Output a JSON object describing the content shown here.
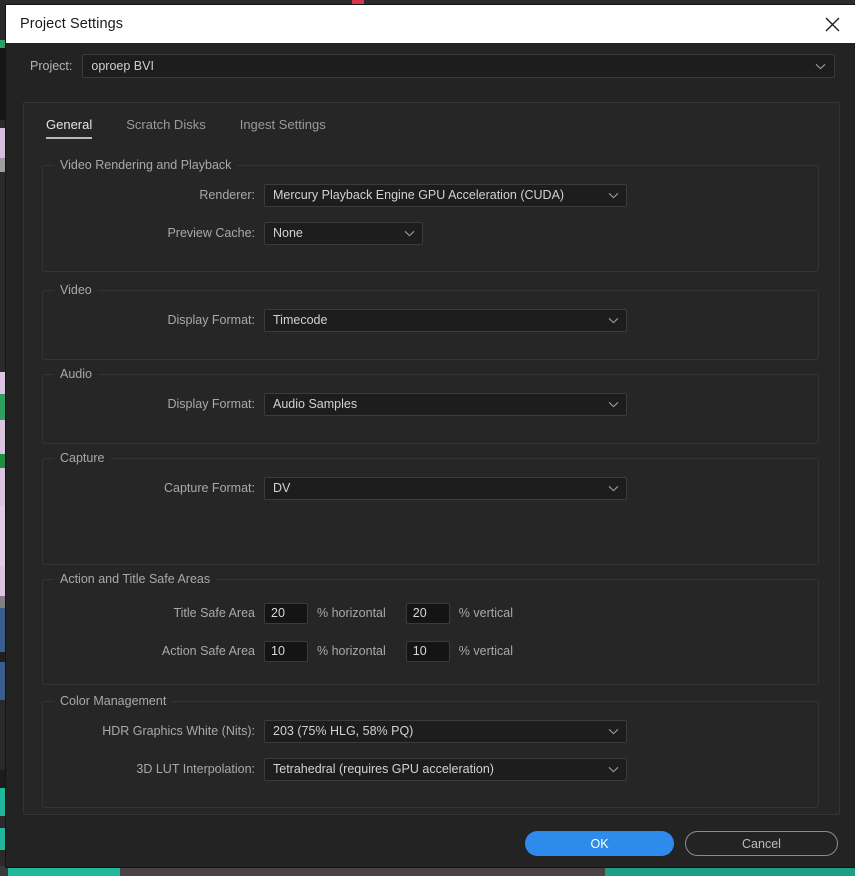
{
  "window": {
    "title": "Project Settings",
    "close_icon": "close-icon"
  },
  "project_row": {
    "label": "Project:",
    "value": "oproep BVI",
    "chevron_icon": "chevron-down-icon"
  },
  "tabs": [
    {
      "label": "General",
      "active": true
    },
    {
      "label": "Scratch Disks",
      "active": false
    },
    {
      "label": "Ingest Settings",
      "active": false
    }
  ],
  "groups": {
    "video_rendering": {
      "legend": "Video Rendering and Playback",
      "renderer": {
        "label": "Renderer:",
        "value": "Mercury Playback Engine GPU Acceleration (CUDA)"
      },
      "preview_cache": {
        "label": "Preview Cache:",
        "value": "None"
      }
    },
    "video": {
      "legend": "Video",
      "display_format": {
        "label": "Display Format:",
        "value": "Timecode"
      }
    },
    "audio": {
      "legend": "Audio",
      "display_format": {
        "label": "Display Format:",
        "value": "Audio Samples"
      }
    },
    "capture": {
      "legend": "Capture",
      "capture_format": {
        "label": "Capture Format:",
        "value": "DV"
      }
    },
    "safe_areas": {
      "legend": "Action and Title Safe Areas",
      "title_safe": {
        "label": "Title Safe Area",
        "horizontal": "20",
        "vertical": "20"
      },
      "action_safe": {
        "label": "Action Safe Area",
        "horizontal": "10",
        "vertical": "10"
      },
      "unit_horizontal": "% horizontal",
      "unit_vertical": "% vertical"
    },
    "color_management": {
      "legend": "Color Management",
      "hdr_white": {
        "label": "HDR Graphics White (Nits):",
        "value": "203 (75% HLG, 58% PQ)"
      },
      "lut_interpolation": {
        "label": "3D LUT Interpolation:",
        "value": "Tetrahedral (requires GPU acceleration)"
      }
    }
  },
  "footer": {
    "ok_label": "OK",
    "cancel_label": "Cancel"
  },
  "colors": {
    "accent_blue": "#2d8ceb",
    "dialog_bg": "#232323",
    "panel_bg": "#262626",
    "field_bg": "#1d1d1d",
    "title_bar_bg": "#ffffff",
    "label_text": "#a9a9a9",
    "value_text": "#d2d2d2",
    "playhead_red": "#d8354a",
    "timeline_teal": "#21b79b"
  }
}
